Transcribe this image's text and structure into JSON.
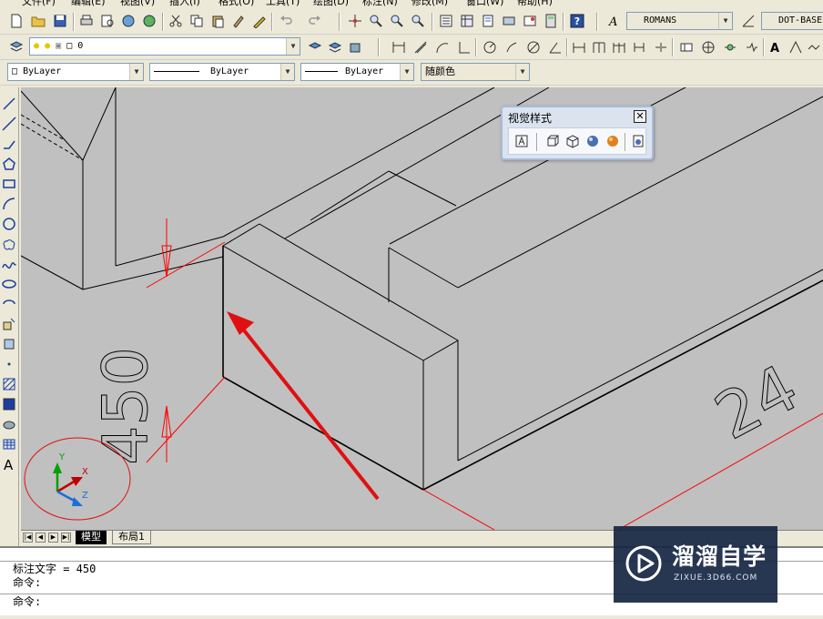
{
  "menu": {
    "items": [
      "文件(F)",
      "编辑(E)",
      "视图(V)",
      "插入(I)",
      "格式(O)",
      "工具(T)",
      "绘图(D)",
      "标注(N)",
      "修改(M)",
      "窗口(W)",
      "帮助(H)"
    ]
  },
  "styles_toolbar": {
    "text_style": "ROMANS",
    "dim_style": "DOT-BASE"
  },
  "layers_toolbar": {
    "layer_name": "0"
  },
  "properties_toolbar": {
    "color": "ByLayer",
    "linetype": "ByLayer",
    "lineweight": "ByLayer",
    "plot_style": "随颜色"
  },
  "visual_styles_panel": {
    "title": "视觉样式"
  },
  "drawing": {
    "dim_text_vertical": "450",
    "dim_text_horizontal": "24",
    "ucs": {
      "x": "X",
      "y": "Y",
      "z": "Z"
    },
    "colors": {
      "background": "#c0c0c0",
      "geometry": "#000000",
      "dimension": "#ff0000",
      "annotation": "#e01010"
    }
  },
  "layout_tabs": {
    "tabs": [
      "模型",
      "布局1"
    ],
    "active": "模型"
  },
  "command": {
    "lines": [
      "标注文字 = 450",
      "命令:",
      "命令:"
    ]
  },
  "watermark": {
    "cn": "溜溜自学",
    "en": "ZIXUE.3D66.COM"
  },
  "colors": {
    "chrome": "#ece9d8",
    "canvas": "#c0c0c0",
    "panel_bg": "#dbe3ef",
    "accent_red": "#ff0000"
  }
}
